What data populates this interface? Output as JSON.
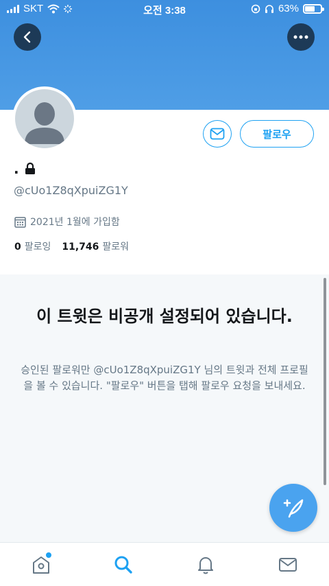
{
  "status_bar": {
    "carrier": "SKT",
    "time": "오전 3:38",
    "battery": "63%",
    "battery_level": 0.63
  },
  "header": {
    "back_icon": "chevron-left-icon",
    "more_icon": "ellipsis-icon"
  },
  "profile": {
    "display_name": ".",
    "protected_icon": "lock-icon",
    "handle": "@cUo1Z8qXpuiZG1Y",
    "joined": "2021년 1월에 가입함",
    "following_count": "0",
    "following_label": "팔로잉",
    "followers_count": "11,746",
    "followers_label": "팔로워",
    "follow_button": "팔로우"
  },
  "private_notice": {
    "title": "이 트윗은 비공개 설정되어 있습니다.",
    "description": "승인된 팔로워만 @cUo1Z8qXpuiZG1Y 님의 트윗과 전체 프로필을 볼 수 있습니다. \"팔로우\" 버튼을 탭해 팔로우 요청을 보내세요."
  },
  "fab": {
    "icon": "compose-tweet-icon"
  },
  "tab_bar": {
    "items": [
      "home-icon",
      "search-icon",
      "bell-icon",
      "mail-icon"
    ],
    "active": "search-icon"
  },
  "colors": {
    "banner": "#4a9be4",
    "accent": "#1da1f2",
    "secondary_text": "#657786",
    "panel_bg": "#f5f8fa"
  }
}
